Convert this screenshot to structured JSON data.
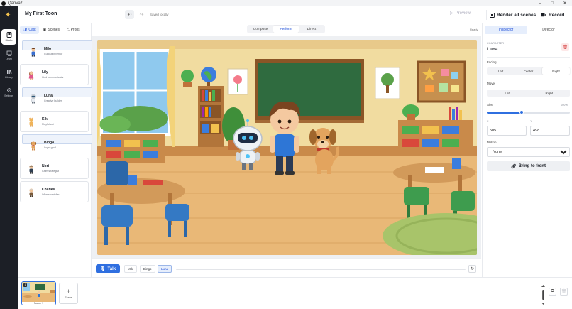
{
  "window": {
    "app_name": "Qanvaz",
    "controls": [
      "–",
      "□",
      "✕"
    ]
  },
  "rail": [
    {
      "label": "Studio",
      "icon": "studio-icon",
      "active": true
    },
    {
      "label": "Learn",
      "icon": "learn-icon",
      "active": false
    },
    {
      "label": "Library",
      "icon": "library-icon",
      "active": false
    },
    {
      "label": "Settings",
      "icon": "gear-icon",
      "active": false
    }
  ],
  "topbar": {
    "project_title": "My First Toon",
    "saved_status": "Saved locally",
    "preview_label": "Preview",
    "render_label": "Render all scenes",
    "record_label": "Record"
  },
  "left": {
    "tabs": [
      {
        "label": "Cast",
        "icon": "people-icon",
        "active": true
      },
      {
        "label": "Scenes",
        "icon": "image-icon",
        "active": false
      },
      {
        "label": "Props",
        "icon": "props-icon",
        "active": false
      }
    ],
    "characters": [
      {
        "name": "Milo",
        "role": "Curious inventor",
        "in_scene": true,
        "selected": true
      },
      {
        "name": "Lily",
        "role": "Kind communicator",
        "in_scene": false,
        "selected": false
      },
      {
        "name": "Luna",
        "role": "Creative builder",
        "in_scene": true,
        "selected": true
      },
      {
        "name": "Kiki",
        "role": "Playful cat",
        "in_scene": false,
        "selected": false
      },
      {
        "name": "Bingo",
        "role": "Loyal goof",
        "in_scene": true,
        "selected": true
      },
      {
        "name": "Nori",
        "role": "Calm strategist",
        "in_scene": false,
        "selected": false
      },
      {
        "name": "Charles",
        "role": "Wise storyteller",
        "in_scene": false,
        "selected": false
      }
    ]
  },
  "center": {
    "modes": [
      {
        "label": "Compose",
        "active": false
      },
      {
        "label": "Perform",
        "active": true
      },
      {
        "label": "Direct",
        "active": false
      }
    ],
    "status": "Ready",
    "talk_label": "Talk",
    "speakers": [
      {
        "label": "Milo",
        "active": false
      },
      {
        "label": "Bingo",
        "active": false
      },
      {
        "label": "Luna",
        "active": true
      }
    ],
    "playback_progress": 0
  },
  "inspector": {
    "tabs": [
      {
        "label": "Inspector",
        "active": true
      },
      {
        "label": "Director",
        "active": false
      }
    ],
    "section_label": "CHARACTER",
    "character_name": "Luna",
    "facing_label": "Facing",
    "facing_options": [
      {
        "label": "Left",
        "active": false
      },
      {
        "label": "Center",
        "active": false
      },
      {
        "label": "Right",
        "active": true
      }
    ],
    "move_label": "Move",
    "move_options": [
      {
        "label": "Left",
        "active": false
      },
      {
        "label": "Right",
        "active": false
      }
    ],
    "size_label": "Size",
    "size_value_text": "100%",
    "size_fraction": 0.42,
    "x_label": "X",
    "y_label": "Y",
    "x_value": "505",
    "y_value": "498",
    "motion_label": "Motion",
    "motion_value": "None",
    "bring_front_label": "Bring to front"
  },
  "bottom": {
    "scene_thumb_label": "Scene 1",
    "scene_number": "1",
    "add_scene_label": "Scene",
    "add_symbol": "+"
  },
  "colors": {
    "accent": "#2f6fe0",
    "rail": "#1c1f26",
    "in_scene": "#38b36b",
    "danger": "#d64545"
  }
}
